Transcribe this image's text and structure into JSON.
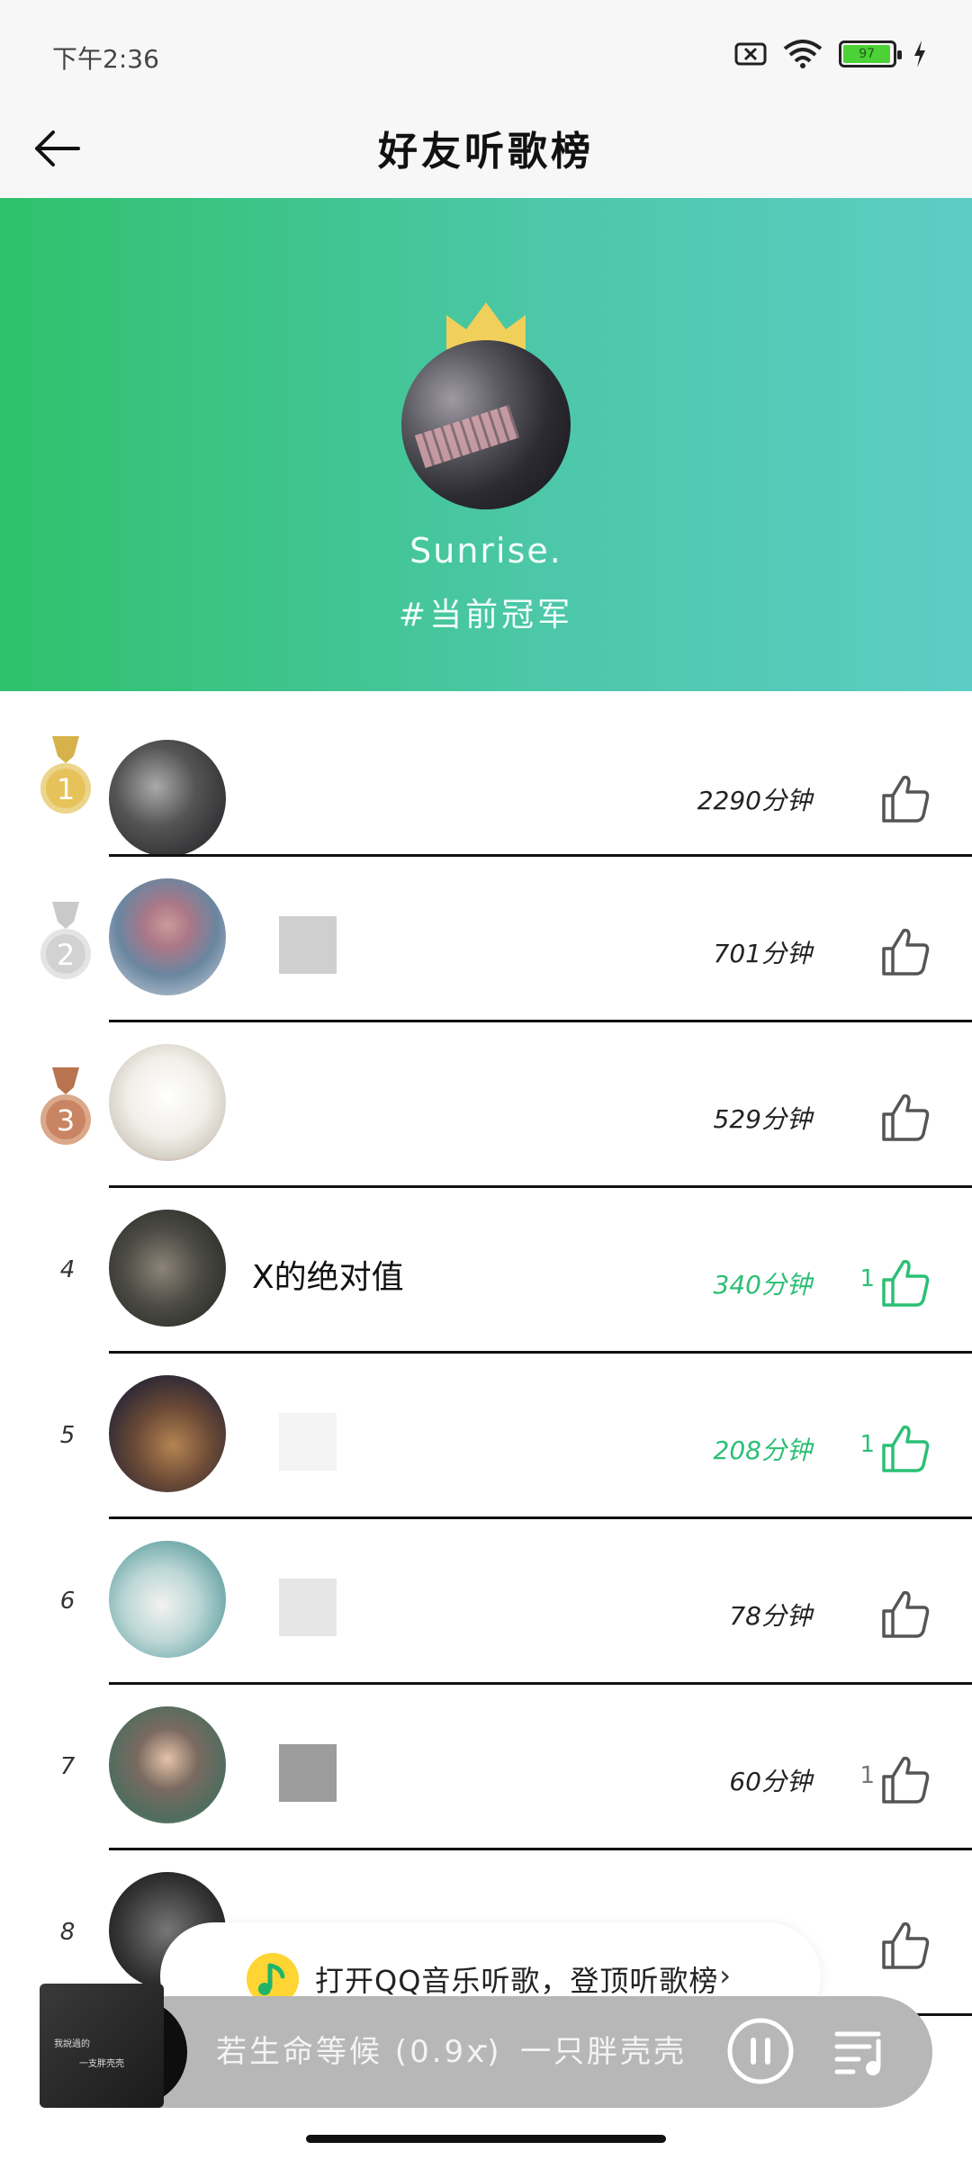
{
  "status_bar": {
    "time": "下午2:36",
    "battery_level": "97",
    "icons": [
      "sim-x-icon",
      "wifi-icon",
      "battery-icon",
      "charging-icon"
    ]
  },
  "header": {
    "title": "好友听歌榜",
    "back_icon": "arrow-left-icon"
  },
  "champion": {
    "name": "Sunrise.",
    "tag": "#当前冠军"
  },
  "accent_colors": {
    "green": "#2bbf75",
    "gold": "#e6c25b",
    "silver": "#c8c8c8",
    "bronze": "#c98563"
  },
  "ranking": [
    {
      "rank": "1",
      "medal": "gold",
      "name": "",
      "duration": "2290分钟",
      "likes": "",
      "liked": false
    },
    {
      "rank": "2",
      "medal": "silver",
      "name": "",
      "duration": "701分钟",
      "likes": "",
      "liked": false
    },
    {
      "rank": "3",
      "medal": "bronze",
      "name": "",
      "duration": "529分钟",
      "likes": "",
      "liked": false
    },
    {
      "rank": "4",
      "medal": "",
      "name": "X的绝对值",
      "duration": "340分钟",
      "likes": "1",
      "liked": true
    },
    {
      "rank": "5",
      "medal": "",
      "name": "",
      "duration": "208分钟",
      "likes": "1",
      "liked": true
    },
    {
      "rank": "6",
      "medal": "",
      "name": "",
      "duration": "78分钟",
      "likes": "",
      "liked": false
    },
    {
      "rank": "7",
      "medal": "",
      "name": "",
      "duration": "60分钟",
      "likes": "1",
      "liked": false
    },
    {
      "rank": "8",
      "medal": "",
      "name": "",
      "duration": "",
      "likes": "",
      "liked": false
    }
  ],
  "prompt": {
    "text": "打开QQ音乐听歌，登顶听歌榜",
    "chevron": "›"
  },
  "player": {
    "song": "若生命等候 (0.9x)",
    "separator": "-",
    "artist": "一只胖壳壳",
    "cover_text_1": "我說過的",
    "cover_text_2": "一支胖壳壳"
  }
}
